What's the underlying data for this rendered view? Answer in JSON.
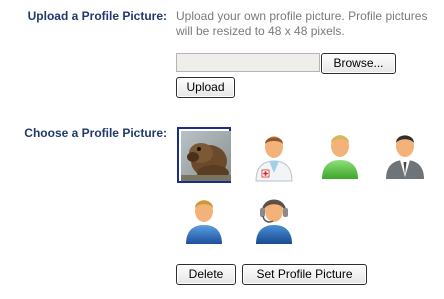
{
  "upload": {
    "label": "Upload a Profile Picture:",
    "description": "Upload your own profile picture. Profile pictures will be resized to 48 x 48 pixels.",
    "browse_label": "Browse...",
    "upload_label": "Upload"
  },
  "choose": {
    "label": "Choose a Profile Picture:",
    "avatars": [
      {
        "name": "user-photo",
        "icon": "prairie-dog-photo",
        "selected": true
      },
      {
        "name": "doctor",
        "icon": "doctor-avatar-icon",
        "selected": false
      },
      {
        "name": "green-user",
        "icon": "user-green-icon",
        "selected": false
      },
      {
        "name": "businessman",
        "icon": "businessman-avatar-icon",
        "selected": false
      },
      {
        "name": "blue-user",
        "icon": "user-blue-icon",
        "selected": false
      },
      {
        "name": "support-headset",
        "icon": "headset-avatar-icon",
        "selected": false
      }
    ],
    "delete_label": "Delete",
    "set_label": "Set Profile Picture"
  }
}
